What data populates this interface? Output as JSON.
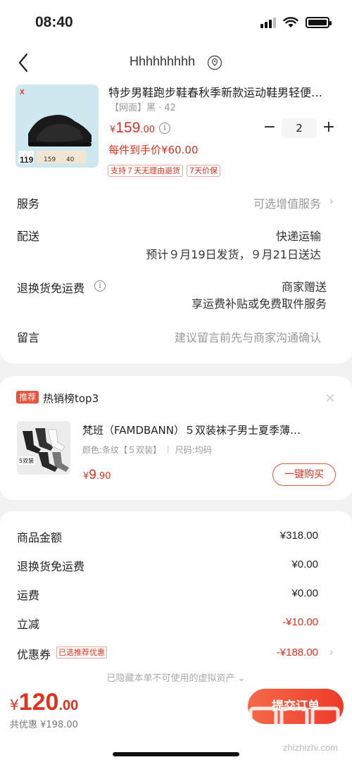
{
  "status_bar": {
    "time": "08:40"
  },
  "nav": {
    "shop_name": "Hhhhhhhhh"
  },
  "product": {
    "title": "特步男鞋跑步鞋春秋季新款运动鞋男轻便…",
    "spec": "【网面】黑 · 42",
    "price_currency": "¥",
    "price_int": "159",
    "price_dec": ".00",
    "quantity": "2",
    "each_price_label": "每件到手价¥60.00",
    "tags": [
      "支持７天无理由退货",
      "7天价保"
    ],
    "image_badge": "119",
    "image_mini": [
      "159",
      "40"
    ]
  },
  "rows": {
    "service_label": "服务",
    "service_value": "可选增值服务",
    "delivery_label": "配送",
    "delivery_method": "快递运输",
    "delivery_time": "预计９月19日发货，９月21日送达",
    "return_label": "退换货免运费",
    "return_value1": "商家赠送",
    "return_value2": "享运费补贴或免费取件服务",
    "message_label": "留言",
    "message_placeholder": "建议留言前先与商家沟通确认"
  },
  "recommend": {
    "badge": "推荐",
    "title": "热销榜top3",
    "name": "梵班（FAMDBANN）５双装袜子男士夏季薄…",
    "spec": "颜色:条纹【５双装】 ｜ 尺码:均码",
    "price_currency": "¥",
    "price_int": "9",
    "price_dec": ".90",
    "buy_label": "一键购买",
    "image_tag": "5双装"
  },
  "summary": {
    "goods_label": "商品金额",
    "goods_value": "¥318.00",
    "return_label": "退换货免运费",
    "return_value": "¥0.00",
    "shipping_label": "运费",
    "shipping_value": "¥0.00",
    "instant_label": "立减",
    "instant_value": "-¥10.00",
    "coupon_label": "优惠券",
    "coupon_tag": "已选推荐优惠",
    "coupon_value": "-¥188.00",
    "hidden_note": "已隐藏本单不可使用的虚拟资产 ⌄"
  },
  "bottom": {
    "total_currency": "¥",
    "total_int": "120",
    "total_dec": ".00",
    "discount": "共优惠 ¥198.00",
    "submit": "提交订单",
    "watermark": "zhizhizhi.com"
  },
  "colors": {
    "accent": "#e0301e",
    "button": "#ee3a2a"
  }
}
